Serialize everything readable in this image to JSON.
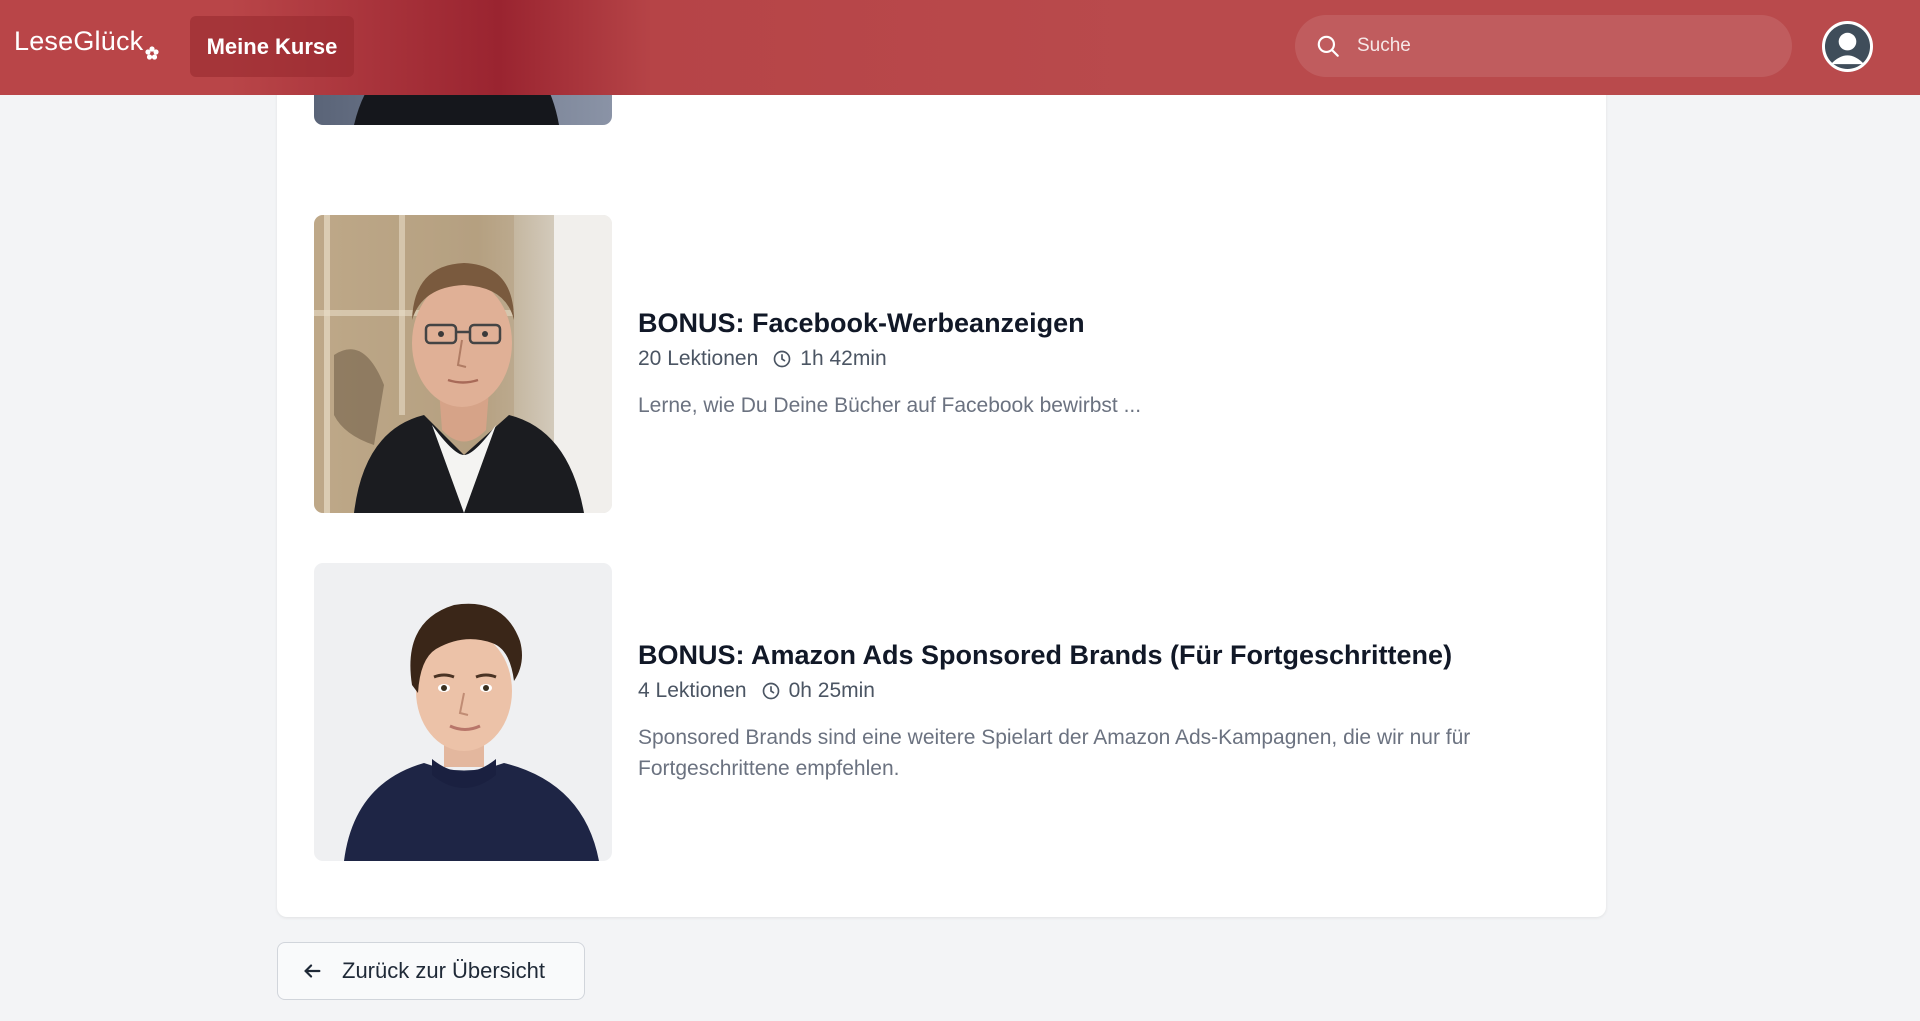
{
  "header": {
    "logo_text": "LeseGlück",
    "nav_label": "Meine Kurse",
    "search_placeholder": "Suche"
  },
  "courses": [
    {
      "title": "BONUS: Facebook-Werbeanzeigen",
      "lessons": "20 Lektionen",
      "duration": "1h 42min",
      "description": "Lerne, wie Du Deine Bücher auf Facebook bewirbst ..."
    },
    {
      "title": "BONUS: Amazon Ads Sponsored Brands (Für Fortgeschrittene)",
      "lessons": "4 Lektionen",
      "duration": "0h 25min",
      "description": "Sponsored Brands sind eine weitere Spielart der Amazon Ads-Kampagnen, die wir nur für Fortgeschrittene empfehlen."
    }
  ],
  "footer": {
    "back_label": "Zurück zur Übersicht"
  },
  "icons": {
    "search": "search-icon",
    "clock": "clock-icon",
    "back": "arrow-left-icon",
    "avatar": "user-avatar-icon"
  },
  "colors": {
    "header": "#b94a4c",
    "background": "#f3f4f6"
  }
}
